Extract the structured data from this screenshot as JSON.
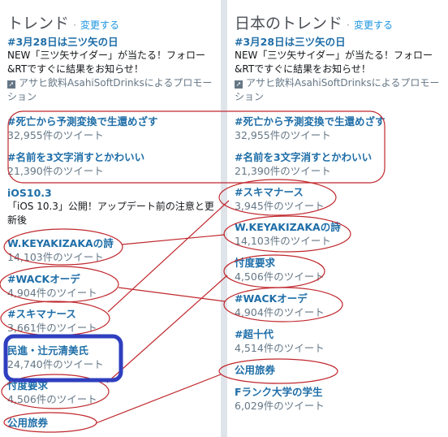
{
  "left": {
    "title": "トレンド",
    "separator": "·",
    "change_label": "変更する",
    "promoted": {
      "name": "#3月28日は三ツ矢の日",
      "text": "NEW「三ツ矢サイダー」が当たる！フォロー&RTですぐに結果をお知らせ！",
      "promo_icon": "promoted-arrow-icon",
      "promo_text": "アサヒ飲料AsahiSoftDrinksによるプロモーション"
    },
    "trends": [
      {
        "name": "#死亡から予測変換で生還めざす",
        "count": "32,955件のツイート"
      },
      {
        "name": "#名前を3文字消すとかわいい",
        "count": "21,390件のツイート"
      },
      {
        "name": "iOS10.3",
        "desc": "「iOS 10.3」公開！アップデート前の注意と更新後"
      },
      {
        "name": "W.KEYAKIZAKAの詩",
        "count": "14,103件のツイート"
      },
      {
        "name": "#WACKオーデ",
        "count": "4,904件のツイート"
      },
      {
        "name": "#スキマナース",
        "count": "3,661件のツイート"
      },
      {
        "name": "民進・辻元清美氏",
        "count": "24,740件のツイート"
      },
      {
        "name": "忖度要求",
        "count": "4,506件のツイート"
      },
      {
        "name": "公用旅券"
      }
    ]
  },
  "right": {
    "title": "日本のトレンド",
    "separator": "·",
    "change_label": "変更する",
    "promoted": {
      "name": "#3月28日は三ツ矢の日",
      "text": "NEW「三ツ矢サイダー」が当たる！フォロー&RTですぐに結果をお知らせ！",
      "promo_icon": "promoted-arrow-icon",
      "promo_text": "アサヒ飲料AsahiSoftDrinksによるプロモーション"
    },
    "trends": [
      {
        "name": "#死亡から予測変換で生還めざす",
        "count": "32,955件のツイート"
      },
      {
        "name": "#名前を3文字消すとかわいい",
        "count": "21,390件のツイート"
      },
      {
        "name": "#スキマナース",
        "count": "3,945件のツイート"
      },
      {
        "name": "W.KEYAKIZAKAの詩",
        "count": "14,103件のツイート"
      },
      {
        "name": "忖度要求",
        "count": "4,506件のツイート"
      },
      {
        "name": "#WACKオーデ",
        "count": "4,904件のツイート"
      },
      {
        "name": "#超十代",
        "count": "4,514件のツイート"
      },
      {
        "name": "公用旅券"
      },
      {
        "name": "Fランク大学の学生",
        "count": "6,029件のツイート"
      }
    ]
  },
  "colors": {
    "annotation_red": "#c0282d",
    "annotation_blue": "#2f3fbf",
    "link": "#1f6ea8"
  }
}
